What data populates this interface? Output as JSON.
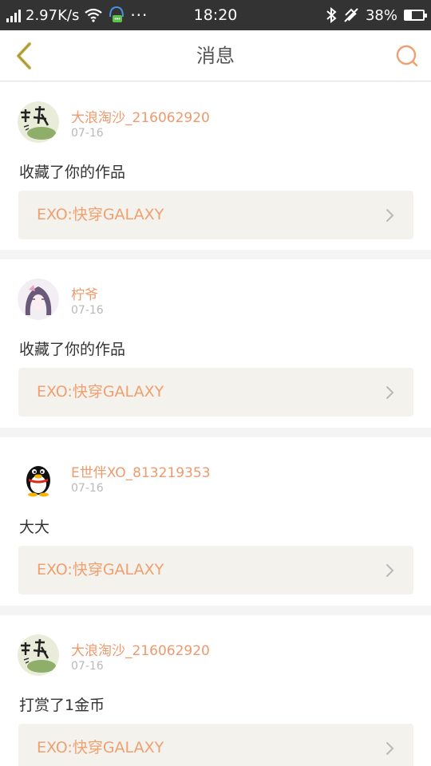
{
  "status_bar": {
    "net_speed": "2.97K/s",
    "more": "···",
    "time": "18:20",
    "battery": "38%",
    "battery_level": 0.38
  },
  "nav": {
    "title": "消息"
  },
  "messages": [
    {
      "user": "大浪淘沙_216062920",
      "date": "07-16",
      "action": "收藏了你的作品",
      "work": "EXO:快穿GALAXY",
      "avatar": "calligraphy-avatar"
    },
    {
      "user": "柠爷",
      "date": "07-16",
      "action": "收藏了你的作品",
      "work": "EXO:快穿GALAXY",
      "avatar": "anime-girl-avatar"
    },
    {
      "user": "E世伴XO_813219353",
      "date": "07-16",
      "action": "大大",
      "work": "EXO:快穿GALAXY",
      "avatar": "qq-penguin-avatar"
    },
    {
      "user": "大浪淘沙_216062920",
      "date": "07-16",
      "action": "打赏了1金币",
      "work": "EXO:快穿GALAXY",
      "avatar": "calligraphy-avatar"
    }
  ],
  "colors": {
    "accent": "#ed9a6c",
    "back_icon": "#c9b64a",
    "status_bg": "#333333"
  }
}
